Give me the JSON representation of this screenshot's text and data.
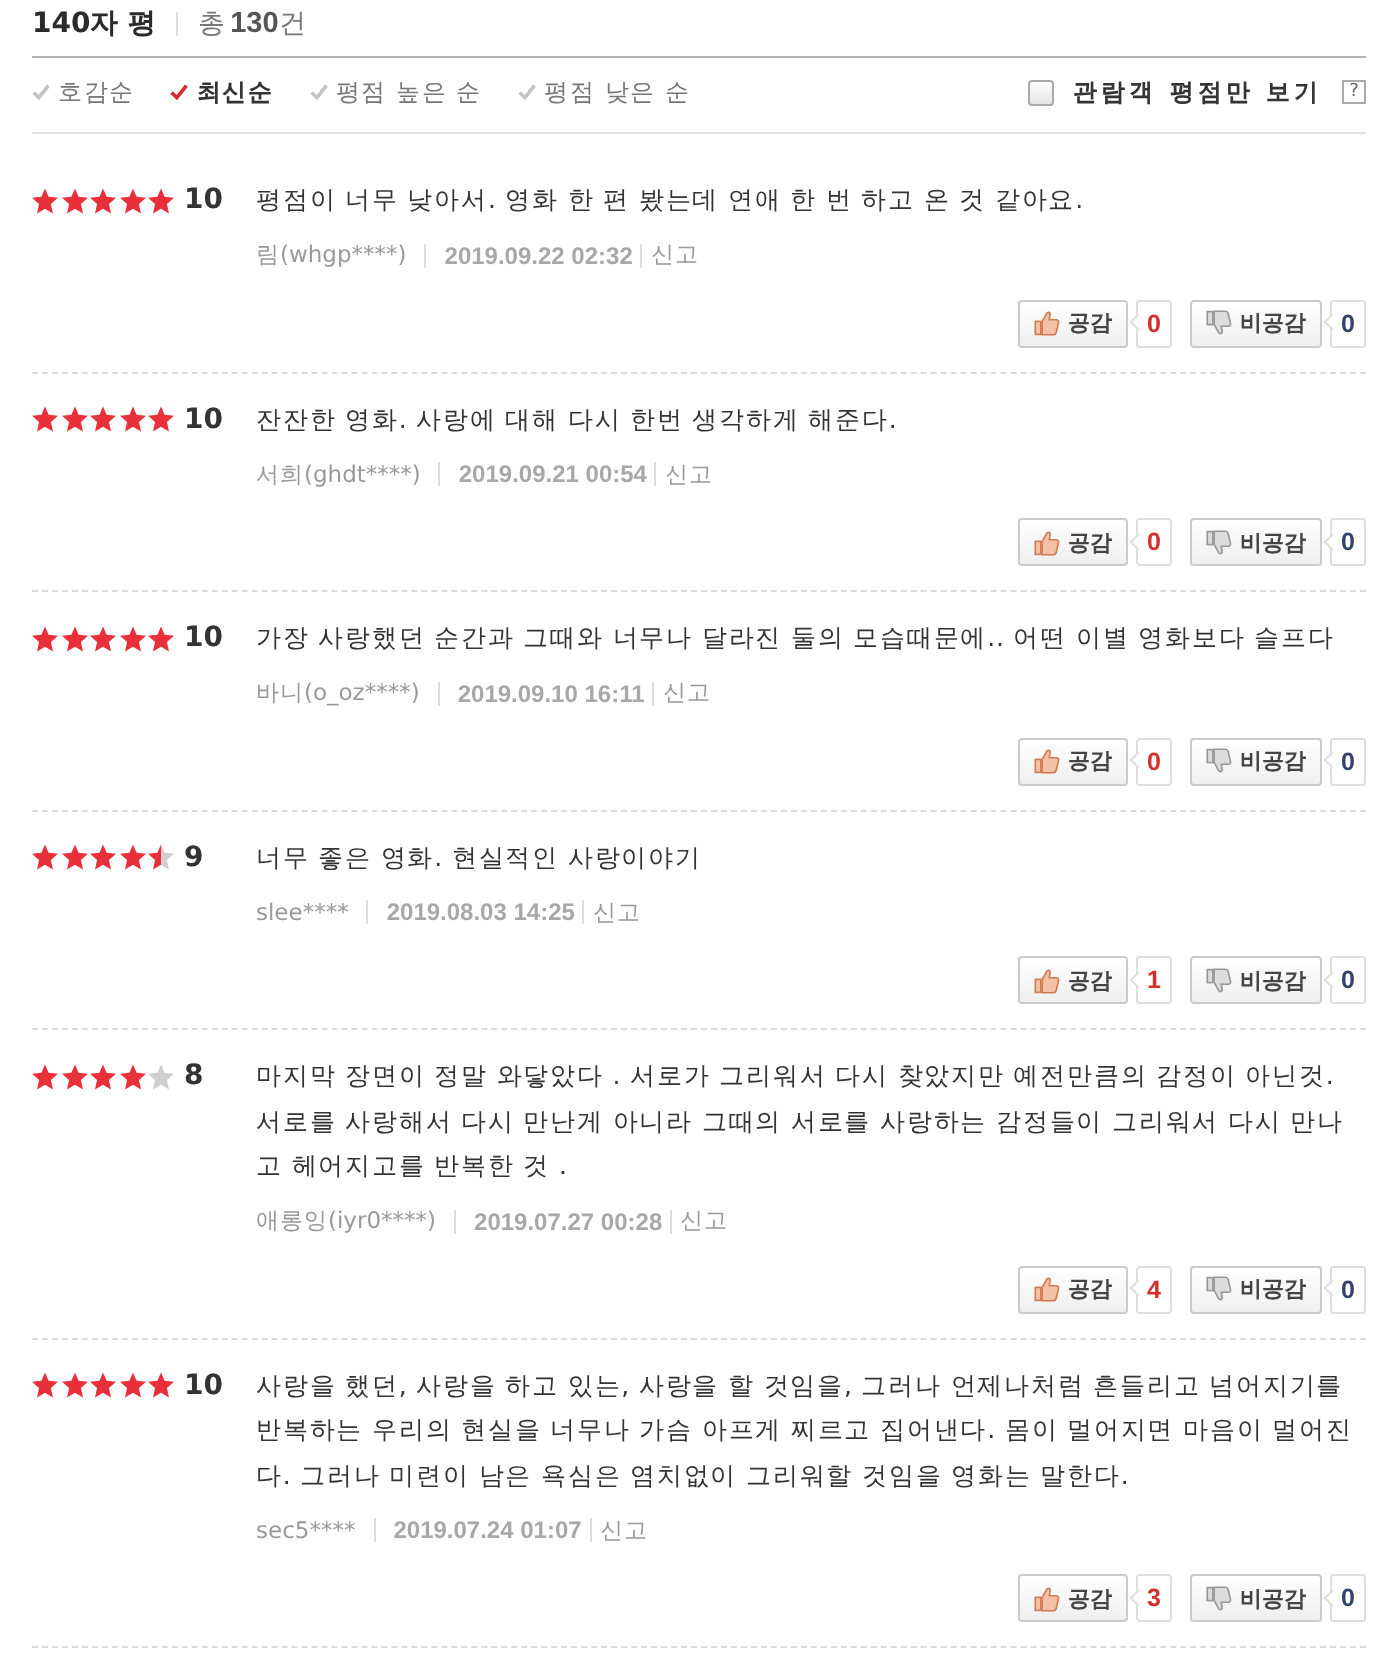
{
  "header": {
    "title": "140자 평",
    "total": "총**130**건"
  },
  "sort_options": [
    {
      "label": "호감순",
      "selected": false
    },
    {
      "label": "최신순",
      "selected": true
    },
    {
      "label": "평점 높은 순",
      "selected": false
    },
    {
      "label": "평점 낮은 순",
      "selected": false
    }
  ],
  "filter": {
    "label": "관람객 평점만 보기",
    "checked": false,
    "help": "?"
  },
  "reviews": [
    {
      "stars": 5,
      "score": "10",
      "text": "평점이 너무 낮아서. 영화 한 편 봤는데 연애 한 번 하고 온 것 같아요.",
      "author": "림(whgp****)",
      "date": "2019.09.22 02:32",
      "report": "신고",
      "like_label": "공감",
      "likes": "0",
      "dislike_label": "비공감",
      "dislikes": "0"
    },
    {
      "stars": 5,
      "score": "10",
      "text": "잔잔한 영화. 사랑에 대해 다시 한번 생각하게 해준다.",
      "author": "서희(ghdt****)",
      "date": "2019.09.21 00:54",
      "report": "신고",
      "like_label": "공감",
      "likes": "0",
      "dislike_label": "비공감",
      "dislikes": "0"
    },
    {
      "stars": 5,
      "score": "10",
      "text": "가장 사랑했던 순간과 그때와 너무나 달라진 둘의 모습때문에.. 어떤 이별 영화보다 슬프다",
      "author": "바니(o_oz****)",
      "date": "2019.09.10 16:11",
      "report": "신고",
      "like_label": "공감",
      "likes": "0",
      "dislike_label": "비공감",
      "dislikes": "0"
    },
    {
      "stars": 4.5,
      "score": "9",
      "text": "너무 좋은 영화. 현실적인 사랑이야기",
      "author": "slee****",
      "date": "2019.08.03 14:25",
      "report": "신고",
      "like_label": "공감",
      "likes": "1",
      "dislike_label": "비공감",
      "dislikes": "0"
    },
    {
      "stars": 4,
      "score": "8",
      "text": "마지막 장면이 정말 와닿았다 . 서로가 그리워서 다시 찾았지만 예전만큼의 감정이 아닌것. 서로를 사랑해서 다시 만난게 아니라 그때의 서로를 사랑하는 감정들이 그리워서 다시 만나고 헤어지고를 반복한 것 .",
      "author": "애롱잉(iyr0****)",
      "date": "2019.07.27 00:28",
      "report": "신고",
      "like_label": "공감",
      "likes": "4",
      "dislike_label": "비공감",
      "dislikes": "0"
    },
    {
      "stars": 5,
      "score": "10",
      "text": "사랑을 했던, 사랑을 하고 있는, 사랑을 할 것임을, 그러나 언제나처럼 흔들리고 넘어지기를 반복하는 우리의 현실을 너무나 가슴 아프게 찌르고 집어낸다. 몸이 멀어지면 마음이 멀어진다. 그러나 미련이 남은 욕심은 염치없이 그리워할 것임을 영화는 말한다.",
      "author": "sec5****",
      "date": "2019.07.24 01:07",
      "report": "신고",
      "like_label": "공감",
      "likes": "3",
      "dislike_label": "비공감",
      "dislikes": "0"
    }
  ]
}
